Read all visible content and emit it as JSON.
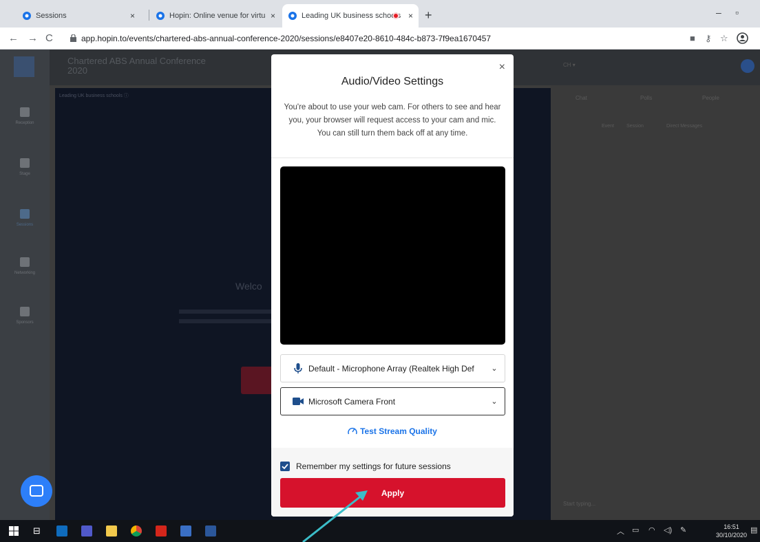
{
  "browser": {
    "tabs": [
      {
        "title": "Sessions",
        "close": "×"
      },
      {
        "title": "Hopin: Online venue for virtual e",
        "close": "×"
      },
      {
        "title": "Leading UK business schools",
        "close": "×",
        "recording": true
      }
    ],
    "new_tab": "+",
    "minimize": "–",
    "maximize": "▫",
    "back": "←",
    "forward": "→",
    "reload": "C",
    "url": "app.hopin.to/events/chartered-abs-annual-conference-2020/sessions/e8407e20-8610-484c-b873-7f9ea1670457"
  },
  "app": {
    "event_title_line1": "Chartered ABS Annual Conference",
    "event_title_line2": "2020",
    "nav": [
      "Reception",
      "Stage",
      "Sessions",
      "Networking",
      "Sponsors"
    ],
    "stage_caption": "Leading UK business schools ⓘ",
    "stage_welcome": "Welco",
    "right_tabs": [
      "Chat",
      "Polls",
      "People"
    ],
    "right_subtabs": [
      "Event",
      "Session",
      "Direct Messages"
    ],
    "chat_placeholder": "Start typing..."
  },
  "modal": {
    "close": "×",
    "title": "Audio/Video Settings",
    "description": "You're about to use your web cam. For others to see and hear you, your browser will request access to your cam and mic. You can still turn them back off at any time.",
    "microphone": "Default - Microphone Array (Realtek High Def",
    "camera": "Microsoft Camera Front",
    "test_stream": "Test Stream Quality",
    "remember_label": "Remember my settings for future sessions",
    "remember_checked": true,
    "apply": "Apply",
    "accent_color": "#d6122c",
    "link_color": "#1a73e8"
  },
  "taskbar": {
    "time": "16:51",
    "date": "30/10/2020"
  }
}
